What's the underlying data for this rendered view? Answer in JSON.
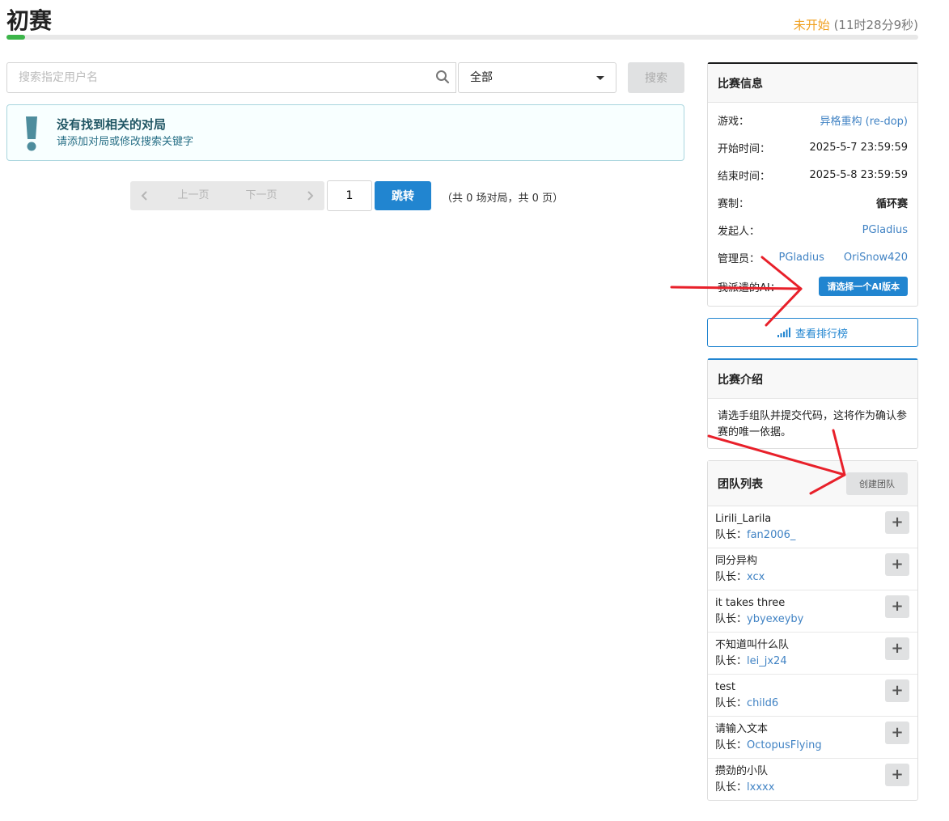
{
  "header": {
    "title": "初赛",
    "status": "未开始",
    "countdown": "(11时28分9秒)",
    "progress_fraction": 0.02
  },
  "search": {
    "placeholder": "搜索指定用户名",
    "filter_value": "全部",
    "button_label": "搜索"
  },
  "alert": {
    "title": "没有找到相关的对局",
    "description": "请添加对局或修改搜索关键字"
  },
  "pagination": {
    "prev_label": "上一页",
    "next_label": "下一页",
    "page_value": "1",
    "jump_label": "跳转",
    "summary": "（共 0 场对局，共 0 页）"
  },
  "info": {
    "heading": "比赛信息",
    "game_label": "游戏：",
    "game_value": "异格重构 (re-dop)",
    "start_label": "开始时间：",
    "start_value": "2025-5-7 23:59:59",
    "end_label": "结束时间：",
    "end_value": "2025-5-8 23:59:59",
    "format_label": "赛制：",
    "format_value": "循环赛",
    "creator_label": "发起人：",
    "creator_value": "PGladius",
    "admins_label": "管理员：",
    "admins": [
      "PGladius",
      "OriSnow420"
    ],
    "ai_label": "我派遣的AI：",
    "ai_button": "请选择一个AI版本"
  },
  "ranking_button": "查看排行榜",
  "intro": {
    "heading": "比赛介绍",
    "body": "请选手组队并提交代码，这将作为确认参赛的唯一依据。"
  },
  "teams": {
    "heading": "团队列表",
    "create_button": "创建团队",
    "captain_label": "队长：",
    "items": [
      {
        "name": "Lirili_Larila",
        "captain": "fan2006_"
      },
      {
        "name": "同分异构",
        "captain": "xcx"
      },
      {
        "name": "it takes three",
        "captain": "ybyexeyby"
      },
      {
        "name": "不知道叫什么队",
        "captain": "lei_jx24"
      },
      {
        "name": "test",
        "captain": "child6"
      },
      {
        "name": "请输入文本",
        "captain": "OctopusFlying"
      },
      {
        "name": "攒劲的小队",
        "captain": "lxxxx"
      }
    ]
  },
  "colors": {
    "accent": "#2185d0",
    "status": "#f0a020",
    "progress": "#3cb54a",
    "annotation": "#e8202a"
  }
}
